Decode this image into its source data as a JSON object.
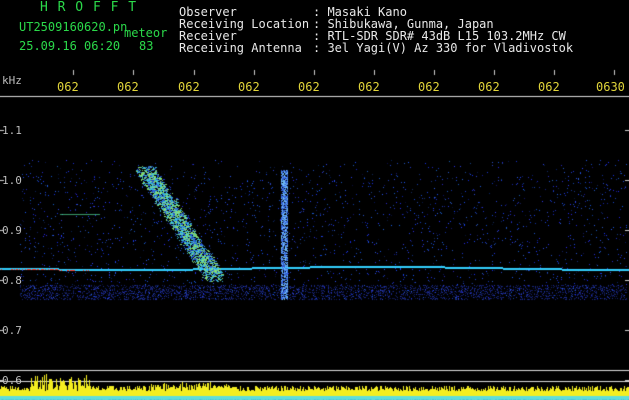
{
  "header": {
    "brand": "H R O F F T",
    "file_name": "UT2509160620.pn",
    "meteor_label": "meteor",
    "datetime": "25.09.16 06:20",
    "count": "83",
    "info_labels": [
      "Observer",
      "Receiving Location",
      "Receiver",
      "Receiving Antenna"
    ],
    "info_values": [
      ": Masaki Kano",
      ": Shibukawa, Gunma, Japan",
      ": RTL-SDR SDR# 43dB L15 103.2MHz CW",
      ": 3el Yagi(V) Az 330 for Vladivostok"
    ]
  },
  "axes": {
    "unit": "kHz",
    "time_ticks": [
      "062",
      "062",
      "062",
      "062",
      "062",
      "062",
      "062",
      "062",
      "062",
      "0630"
    ],
    "freq_ticks": [
      "1.1",
      "1.0",
      "0.9",
      "0.8",
      "0.7",
      "0.6"
    ]
  },
  "colors": {
    "header_green": "#2bd94a",
    "tick_yellow": "#e0d43a",
    "noise_blue": "#1d3bd6",
    "signal_cyan": "#32d0ff",
    "signal_red": "#ff3a2a",
    "strip_yellow": "#f4ee20"
  }
}
